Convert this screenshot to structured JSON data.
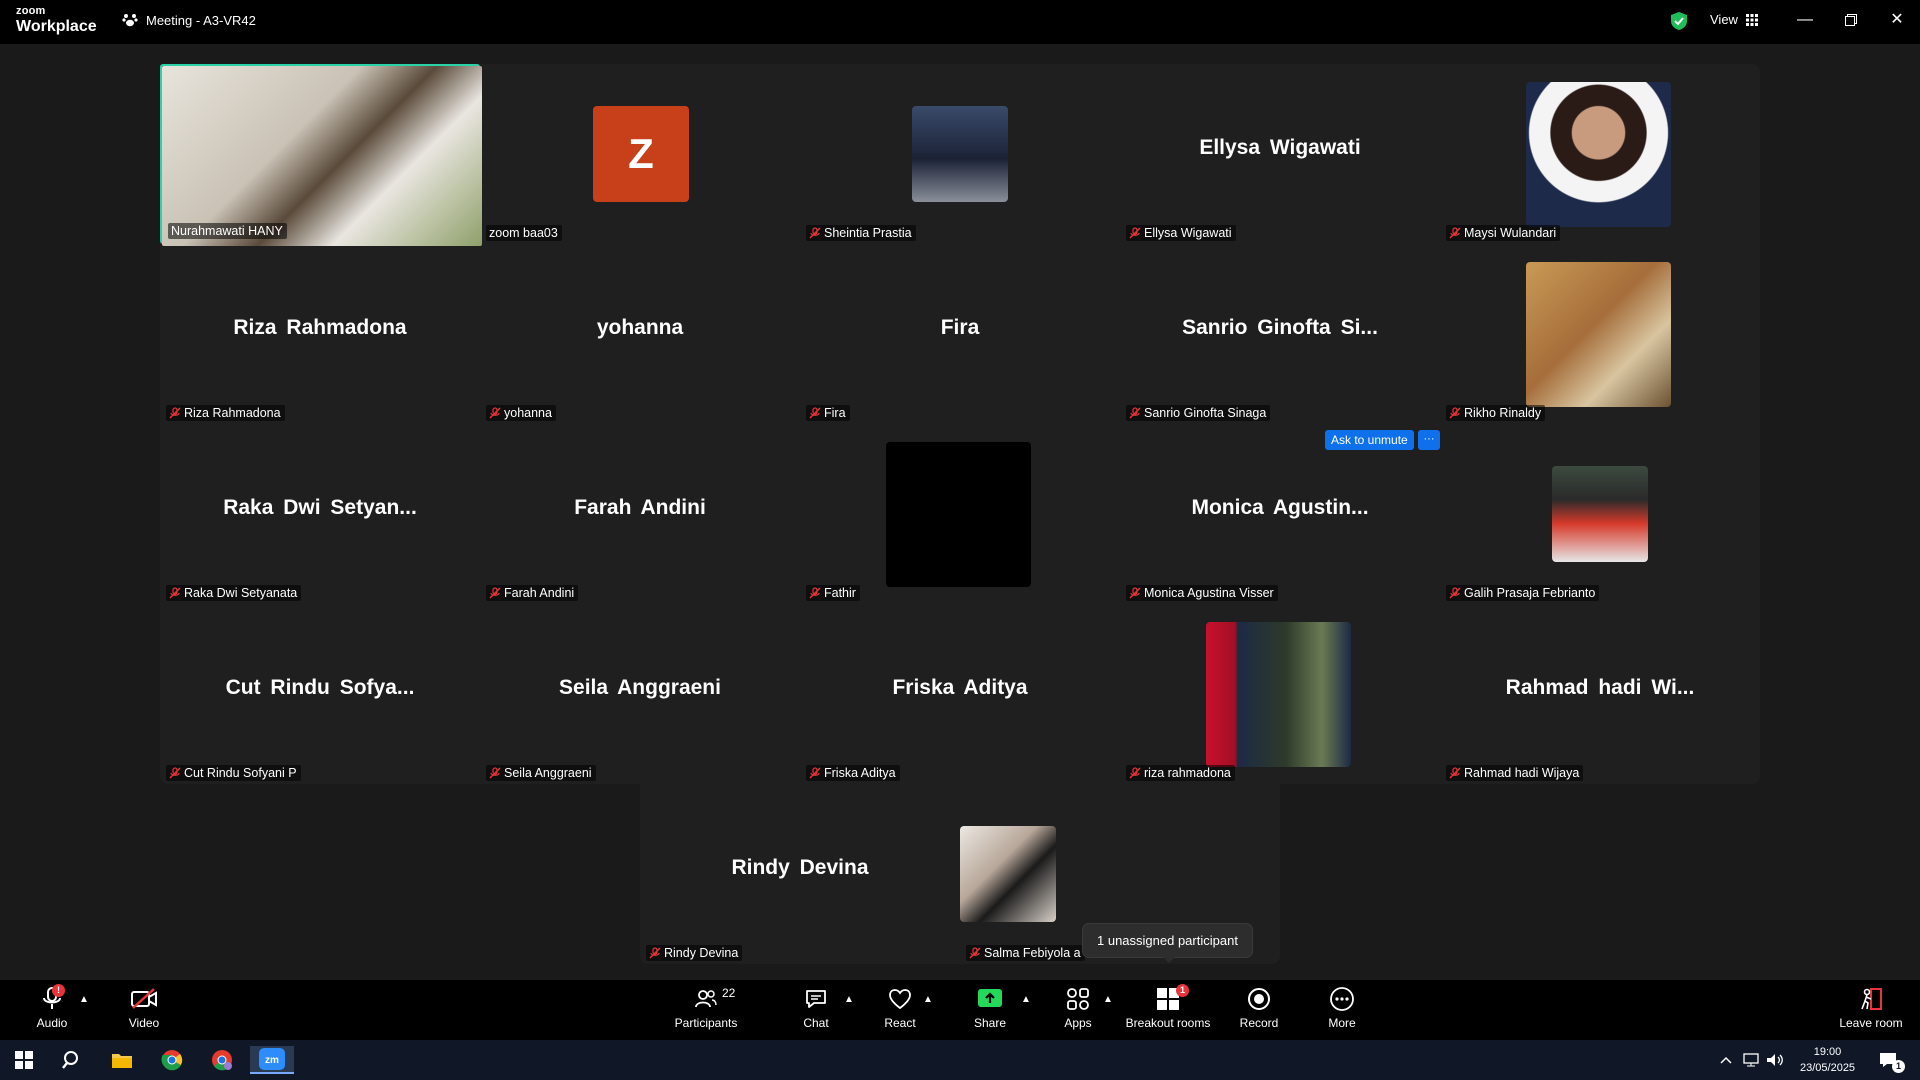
{
  "titlebar": {
    "brand_top": "zoom",
    "brand_bottom": "Workplace",
    "meeting_title": "Meeting - A3-VR42",
    "view_label": "View",
    "controls": [
      "minimize-icon",
      "restore-icon",
      "close-icon"
    ]
  },
  "tiles": [
    {
      "name": "Nurahmawati HANY",
      "display": "",
      "kind": "video",
      "muted": false,
      "active": true
    },
    {
      "name": "zoom baa03",
      "display": "Z",
      "kind": "avatar",
      "muted": false
    },
    {
      "name": "Sheintia Prastia",
      "display": "",
      "kind": "photo",
      "muted": true
    },
    {
      "name": "Ellysa Wigawati",
      "display": "Ellysa Wigawati",
      "kind": "name",
      "muted": true
    },
    {
      "name": "Maysi Wulandari",
      "display": "",
      "kind": "photo",
      "muted": true
    },
    {
      "name": "Riza Rahmadona",
      "display": "Riza Rahmadona",
      "kind": "name",
      "muted": true
    },
    {
      "name": "yohanna",
      "display": "yohanna",
      "kind": "name",
      "muted": true
    },
    {
      "name": "Fira",
      "display": "Fira",
      "kind": "name",
      "muted": true
    },
    {
      "name": "Sanrio Ginofta Sinaga",
      "display": "Sanrio Ginofta Si...",
      "kind": "name",
      "muted": true
    },
    {
      "name": "Rikho Rinaldy",
      "display": "",
      "kind": "photo",
      "muted": true
    },
    {
      "name": "Raka Dwi Setyanata",
      "display": "Raka Dwi Setyan...",
      "kind": "name",
      "muted": true
    },
    {
      "name": "Farah Andini",
      "display": "Farah Andini",
      "kind": "name",
      "muted": true
    },
    {
      "name": "Fathir",
      "display": "",
      "kind": "photo",
      "muted": true
    },
    {
      "name": "Monica Agustina Visser",
      "display": "Monica Agustin...",
      "kind": "name",
      "muted": true
    },
    {
      "name": "Galih Prasaja Febrianto",
      "display": "",
      "kind": "photo",
      "muted": true
    },
    {
      "name": "Cut Rindu Sofyani P",
      "display": "Cut Rindu Sofya...",
      "kind": "name",
      "muted": true
    },
    {
      "name": "Seila Anggraeni",
      "display": "Seila Anggraeni",
      "kind": "name",
      "muted": true
    },
    {
      "name": "Friska Aditya",
      "display": "Friska Aditya",
      "kind": "name",
      "muted": true
    },
    {
      "name": "riza rahmadona",
      "display": "",
      "kind": "photo",
      "muted": true
    },
    {
      "name": "Rahmad hadi Wijaya",
      "display": "Rahmad hadi Wi...",
      "kind": "name",
      "muted": true
    },
    {
      "name": "Rindy Devina",
      "display": "Rindy Devina",
      "kind": "name",
      "muted": true
    },
    {
      "name": "Salma Febiyola a",
      "display": "",
      "kind": "photo",
      "muted": true
    }
  ],
  "ask_unmute": "Ask to unmute",
  "ask_unmute_more": "···",
  "tooltip": "1 unassigned participant",
  "toolbar": {
    "audio": "Audio",
    "video": "Video",
    "participants": "Participants",
    "participants_count": "22",
    "chat": "Chat",
    "react": "React",
    "share": "Share",
    "apps": "Apps",
    "breakout": "Breakout rooms",
    "breakout_badge": "1",
    "record": "Record",
    "more": "More",
    "leave": "Leave room",
    "audio_badge": "!"
  },
  "taskbar": {
    "time": "19:00",
    "date": "23/05/2025",
    "notification_count": "1"
  },
  "colors": {
    "active_border": "#2ad3a7",
    "avatar_z": "#c8401a",
    "unmute_blue": "#0e71eb",
    "share_green": "#23d959",
    "badge_red": "#e8333a"
  }
}
